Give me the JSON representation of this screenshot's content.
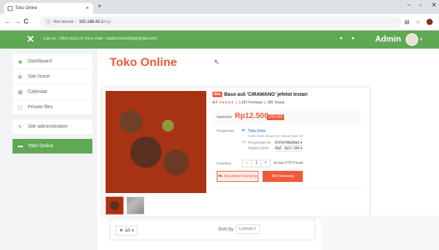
{
  "browser": {
    "tab_title": "Toko Online",
    "tab_close": "×",
    "new_tab": "+",
    "win_min": "−",
    "win_max": "▫",
    "win_close": "✕",
    "back": "←",
    "forward": "→",
    "reload": "C",
    "security": "Not secure",
    "host": "192.168.43.1",
    "path": "/my/",
    "icons": [
      "translate-icon",
      "star-icon",
      "profile-icon"
    ]
  },
  "header": {
    "close_glyph": "✕",
    "contact": "Call us : 0823-8331-9719  E-mail : badluconcer96@gmail.com",
    "bell": "●",
    "chat": "●",
    "admin": "Admin",
    "caret": "▾",
    "accent": "#5fa854"
  },
  "sidebar": {
    "items": [
      {
        "icon": "◉",
        "label": "Dashboard"
      },
      {
        "icon": "✿",
        "label": "Site home"
      },
      {
        "icon": "▦",
        "label": "Calendar"
      },
      {
        "icon": "▢",
        "label": "Private files"
      },
      {
        "icon": "✎",
        "label": "Site administration"
      },
      {
        "icon": "▬",
        "label": "Toko Online"
      }
    ]
  },
  "main": {
    "title": "Toko Online",
    "product": {
      "badge": "Star",
      "name": "Baso asli 'CIRAWANG' jefetot lestari",
      "rating": "4.7",
      "stars": "★★★★★",
      "reviews": "1,682 Penilaian",
      "sold": "385 Terjual",
      "old_price": "Rp15.000",
      "price": "Rp12.500",
      "discount": "17% OFF",
      "shipping_label": "Pengiriman",
      "shop_name": "Toko Onlie",
      "shop_note": "Gratis Ongkir dengan min. belanja Rp45.000",
      "ship_to_label": "Pengiriman Ke",
      "ship_to_value": "KOTA PADANG ▾",
      "ship_cost_label": "Ongkos Kirim",
      "ship_cost_value": "Rp0 - Rp17.300 ▾",
      "qty_label": "Kuantitas",
      "qty_minus": "−",
      "qty_value": "1",
      "qty_plus": "+",
      "stock": "tersisa 97979 buah",
      "cart_btn": "Masukkan Keranjang",
      "buy_btn": "Beli Sekarang"
    },
    "filter_all": "All ▾",
    "sort_by": "Sort by",
    "sort_placeholder": "Course n"
  }
}
